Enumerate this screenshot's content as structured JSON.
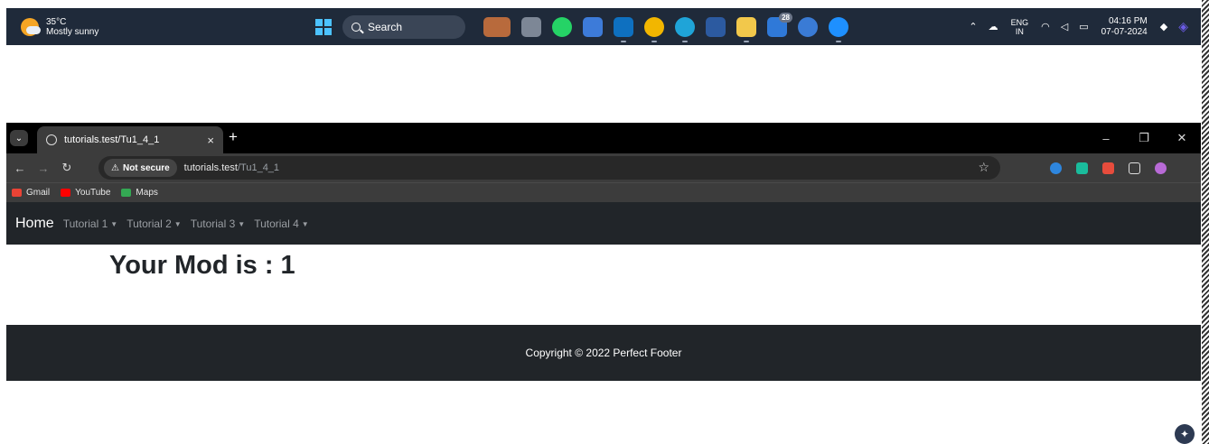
{
  "taskbar": {
    "weather_temp": "35°C",
    "weather_desc": "Mostly sunny",
    "search_label": "Search",
    "store_badge": "28",
    "lang_line1": "ENG",
    "lang_line2": "IN",
    "time": "04:16 PM",
    "date": "07-07-2024"
  },
  "browser": {
    "tab_title": "tutorials.test/Tu1_4_1",
    "security_label": "Not secure",
    "url_host": "tutorials.test",
    "url_path": "/Tu1_4_1",
    "bookmarks": [
      "Gmail",
      "YouTube",
      "Maps"
    ]
  },
  "page": {
    "brand": "Home",
    "nav_items": [
      "Tutorial 1",
      "Tutorial 2",
      "Tutorial 3",
      "Tutorial 4"
    ],
    "heading": "Your Mod is : 1",
    "footer": "Copyright © 2022 Perfect Footer"
  },
  "colors": {
    "navbar_bg": "#212529",
    "footer_bg": "#212529",
    "taskbar_bg": "#1f2a3a",
    "accent": "#4cc2ff"
  }
}
